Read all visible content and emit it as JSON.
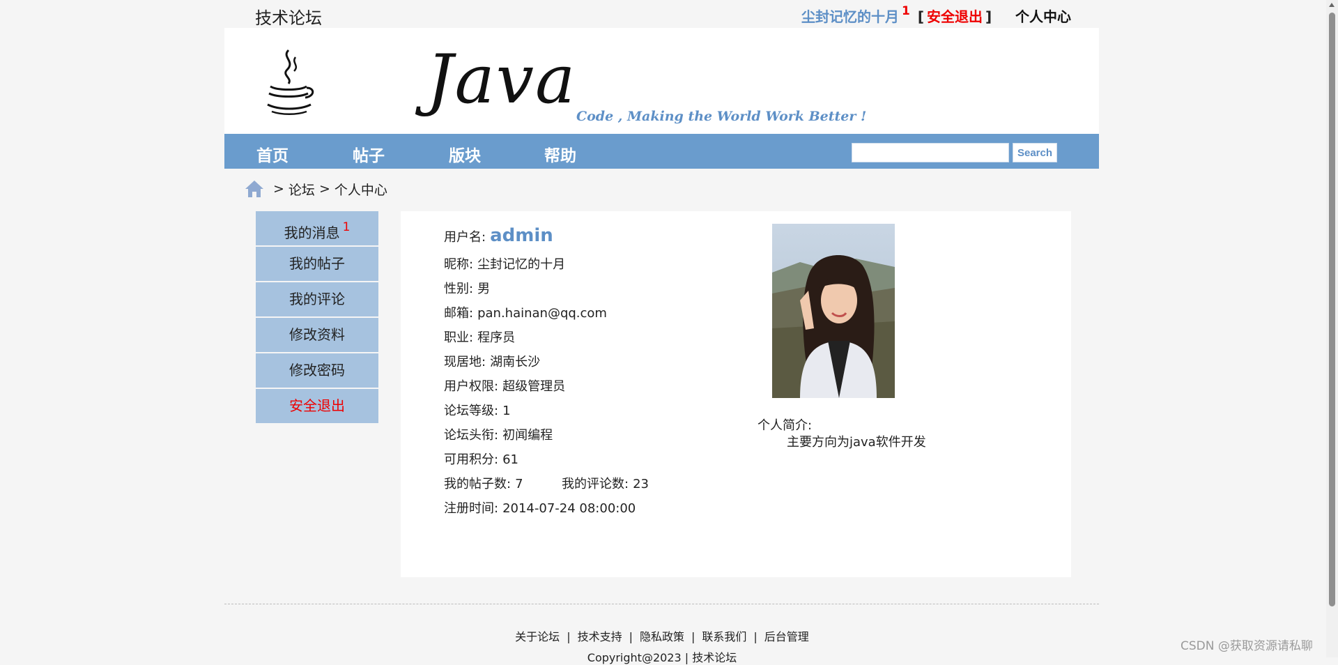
{
  "header": {
    "site_title": "技术论坛",
    "nickname": "尘封记忆的十月",
    "message_badge": "1",
    "bracket_open": "[",
    "logout_label": "安全退出",
    "bracket_close": "]",
    "personal_center_label": "个人中心"
  },
  "banner": {
    "logo_text": "Java",
    "slogan": "Code , Making the World Work Better !"
  },
  "nav": {
    "items": [
      "首页",
      "帖子",
      "版块",
      "帮助"
    ],
    "search_value": "",
    "search_button": "Search"
  },
  "breadcrumb": {
    "items": [
      "论坛",
      "个人中心"
    ],
    "separator": ">"
  },
  "side_menu": {
    "items": [
      {
        "label": "我的消息",
        "badge": "1"
      },
      {
        "label": "我的帖子"
      },
      {
        "label": "我的评论"
      },
      {
        "label": "修改资料"
      },
      {
        "label": "修改密码"
      },
      {
        "label": "安全退出"
      }
    ]
  },
  "profile": {
    "username_label": "用户名:",
    "username": "admin",
    "nickname_label": "昵称:",
    "nickname": "尘封记忆的十月",
    "gender_label": "性别:",
    "gender": "男",
    "email_label": "邮箱:",
    "email": "pan.hainan@qq.com",
    "job_label": "职业:",
    "job": "程序员",
    "location_label": "现居地:",
    "location": "湖南长沙",
    "role_label": "用户权限:",
    "role": "超级管理员",
    "level_label": "论坛等级:",
    "level": "1",
    "title_label": "论坛头衔:",
    "title": "初闻编程",
    "points_label": "可用积分:",
    "points": "61",
    "posts_label": "我的帖子数:",
    "posts": "7",
    "comments_label": "我的评论数:",
    "comments": "23",
    "registered_label": "注册时间:",
    "registered": "2014-07-24 08:00:00",
    "bio_label": "个人简介:",
    "bio": "主要方向为java软件开发"
  },
  "footer": {
    "links": [
      "关于论坛",
      "技术支持",
      "隐私政策",
      "联系我们",
      "后台管理"
    ],
    "separator": "|",
    "copyright": "Copyright@2023 | 技术论坛"
  },
  "watermark": "CSDN @获取资源请私聊",
  "colors": {
    "accent": "#6a9ccd",
    "menu_bg": "#a6c2df",
    "link_blue": "#5d8fc6",
    "alert_red": "#e00000"
  }
}
